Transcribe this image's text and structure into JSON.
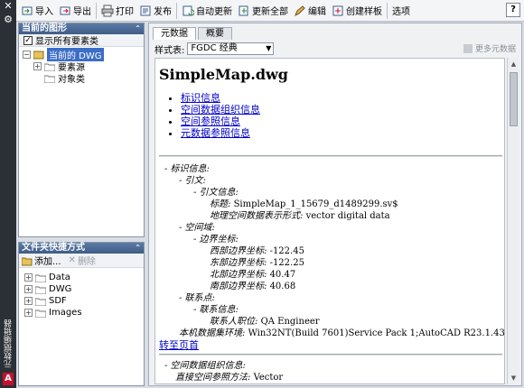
{
  "palette_title": "元数据编辑器",
  "toolbar": {
    "import": "导入",
    "export": "导出",
    "print": "打印",
    "publish": "发布",
    "auto_update": "自动更新",
    "update_all": "更新全部",
    "edit": "编辑",
    "create_template": "创建样板",
    "options": "选项",
    "help": "?"
  },
  "current_drawing": {
    "title": "当前的图形",
    "show_all": "显示所有要素类",
    "tree": [
      "当前的 DWG",
      "要素源",
      "对象类"
    ]
  },
  "folder_shortcuts": {
    "title": "文件夹快捷方式",
    "add": "添加...",
    "remove": "删除",
    "folders": [
      "Data",
      "DWG",
      "SDF",
      "Images"
    ]
  },
  "tabs": [
    "元数据",
    "概要"
  ],
  "style_label": "样式表:",
  "style_value": "FGDC 经典",
  "more_metadata": "更多元数据",
  "doc": {
    "title": "SimpleMap.dwg",
    "toc": [
      "标识信息",
      "空间数据组织信息",
      "空间参照信息",
      "元数据参照信息"
    ],
    "lines": [
      {
        "label": "- 标识信息:",
        "value": ""
      },
      {
        "label": "- 引文:",
        "value": ""
      },
      {
        "label": "- 引文信息:",
        "value": ""
      },
      {
        "label": "标题:",
        "value": "SimpleMap_1_15679_d1489299.sv$"
      },
      {
        "label": "地理空间数据表示形式:",
        "value": "vector digital data"
      },
      {
        "label": "- 空间域:",
        "value": ""
      },
      {
        "label": "- 边界坐标:",
        "value": ""
      },
      {
        "label": "西部边界坐标:",
        "value": "-122.45"
      },
      {
        "label": "东部边界坐标:",
        "value": "-122.25"
      },
      {
        "label": "北部边界坐标:",
        "value": "40.47"
      },
      {
        "label": "南部边界坐标:",
        "value": "40.68"
      },
      {
        "label": "- 联系点:",
        "value": ""
      },
      {
        "label": "- 联系信息:",
        "value": ""
      },
      {
        "label": "联系人职位:",
        "value": "QA Engineer"
      },
      {
        "label": "本机数据集环境:",
        "value": "Win32NT(Build 7601)Service Pack 1;AutoCAD R23.1.43.0.0"
      },
      {
        "label": "- 空间数据组织信息:",
        "value": ""
      },
      {
        "label": "直接空间参照方法:",
        "value": "Vector"
      }
    ],
    "back_to_top": "转至页首"
  }
}
